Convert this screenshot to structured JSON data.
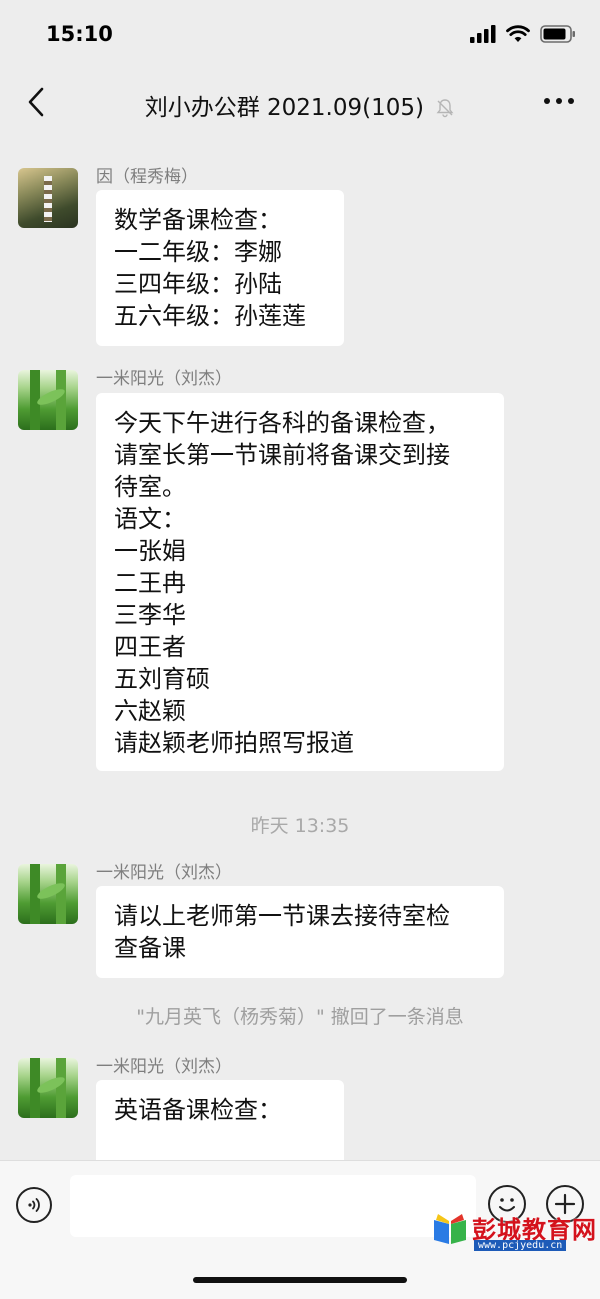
{
  "status_bar": {
    "time": "15:10"
  },
  "nav": {
    "title": "刘小办公群 2021.09(105)"
  },
  "messages": [
    {
      "sender": "因（程秀梅）",
      "lines": [
        "数学备课检查：",
        "一二年级：李娜",
        "三四年级：孙陆",
        "五六年级：孙莲莲"
      ]
    },
    {
      "sender": "一米阳光（刘杰）",
      "lines": [
        "今天下午进行各科的备课检查，",
        "请室长第一节课前将备课交到接",
        "待室。",
        "语文：",
        "一张娟",
        "二王冉",
        "三李华",
        "四王者",
        "五刘育硕",
        "六赵颖",
        "请赵颖老师拍照写报道"
      ]
    },
    {
      "sender": "一米阳光（刘杰）",
      "lines": [
        "请以上老师第一节课去接待室检",
        "查备课"
      ]
    },
    {
      "sender": "一米阳光（刘杰）",
      "lines": [
        "英语备课检查："
      ]
    }
  ],
  "time_divider": "昨天 13:35",
  "recall_notice": "\"九月英飞（杨秀菊）\" 撤回了一条消息",
  "watermark": {
    "title": "彭城教育网",
    "url": "www.pcjyedu.cn"
  },
  "icons": {
    "back": "chevron-left-icon",
    "mute": "bell-off-icon",
    "more": "more-icon",
    "voice": "voice-icon",
    "emoji": "emoji-icon",
    "plus": "plus-icon"
  }
}
